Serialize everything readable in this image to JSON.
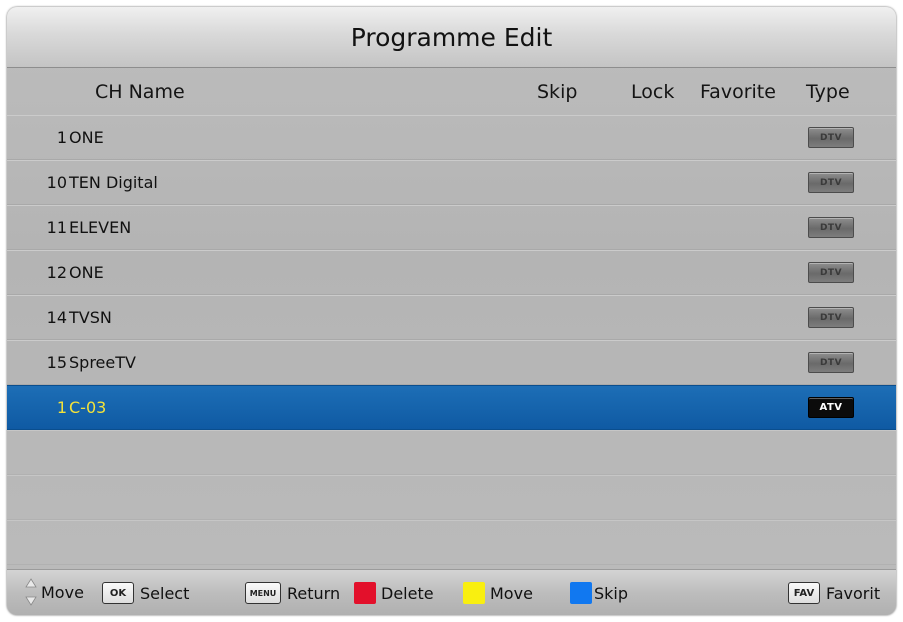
{
  "title": "Programme Edit",
  "columns": {
    "ch_name": "CH Name",
    "skip": "Skip",
    "lock": "Lock",
    "favorite": "Favorite",
    "type": "Type"
  },
  "channels": [
    {
      "number": "1",
      "name": "ONE",
      "type": "DTV"
    },
    {
      "number": "10",
      "name": "TEN Digital",
      "type": "DTV"
    },
    {
      "number": "11",
      "name": "ELEVEN",
      "type": "DTV"
    },
    {
      "number": "12",
      "name": "ONE",
      "type": "DTV"
    },
    {
      "number": "14",
      "name": "TVSN",
      "type": "DTV"
    },
    {
      "number": "15",
      "name": "SpreeTV",
      "type": "DTV"
    },
    {
      "number": "1",
      "name": "C-03",
      "type": "ATV"
    }
  ],
  "footer": {
    "move_label": "Move",
    "ok_key": "OK",
    "select_label": "Select",
    "menu_key": "MENU",
    "return_label": "Return",
    "delete_label": "Delete",
    "yellow_move_label": "Move",
    "skip_label": "Skip",
    "fav_key": "FAV",
    "favorite_label": "Favorit"
  },
  "colors": {
    "red": "#e3102b",
    "yellow": "#f9ef10",
    "blue": "#1178f0",
    "selection": "#0f5aa3",
    "selected_text": "#f3e23a"
  }
}
